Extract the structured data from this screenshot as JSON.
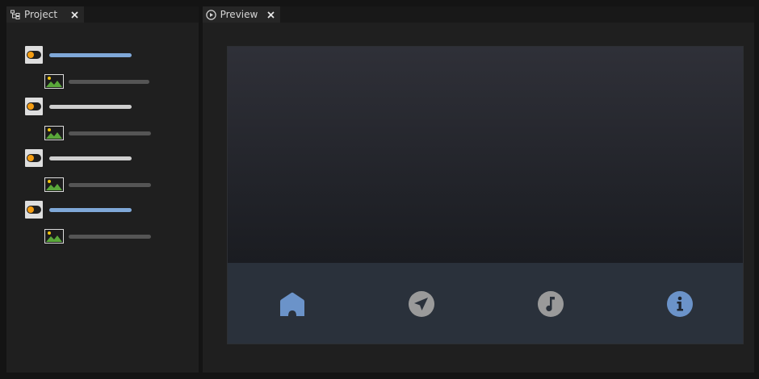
{
  "project_panel": {
    "title": "Project",
    "tab_icon": "node-tree-icon",
    "close_icon": "close-icon",
    "items": [
      {
        "icon": "toggle-icon",
        "type": "toggle",
        "bar_color": "#7fa8d8",
        "selected": true
      },
      {
        "icon": "image-icon",
        "type": "image",
        "bar_color": "#555555"
      },
      {
        "icon": "toggle-icon",
        "type": "toggle",
        "bar_color": "#cfcfcf"
      },
      {
        "icon": "image-icon",
        "type": "image",
        "bar_color": "#555555"
      },
      {
        "icon": "toggle-icon",
        "type": "toggle",
        "bar_color": "#cfcfcf"
      },
      {
        "icon": "image-icon",
        "type": "image",
        "bar_color": "#555555"
      },
      {
        "icon": "toggle-icon",
        "type": "toggle",
        "bar_color": "#7fa8d8",
        "selected": true
      },
      {
        "icon": "image-icon",
        "type": "image",
        "bar_color": "#555555"
      }
    ]
  },
  "preview_panel": {
    "title": "Preview",
    "tab_icon": "play-circle-icon",
    "close_icon": "close-icon",
    "nav": [
      {
        "icon": "home-icon",
        "color": "#6b93c9",
        "active": true
      },
      {
        "icon": "send-icon",
        "color": "#9a9a9a"
      },
      {
        "icon": "music-note-icon",
        "color": "#9a9a9a"
      },
      {
        "icon": "info-icon",
        "color": "#6b93c9"
      }
    ]
  },
  "colors": {
    "accent": "#7fa8d8",
    "toggle_knob": "#f39c12",
    "image_green": "#5aa83a"
  }
}
